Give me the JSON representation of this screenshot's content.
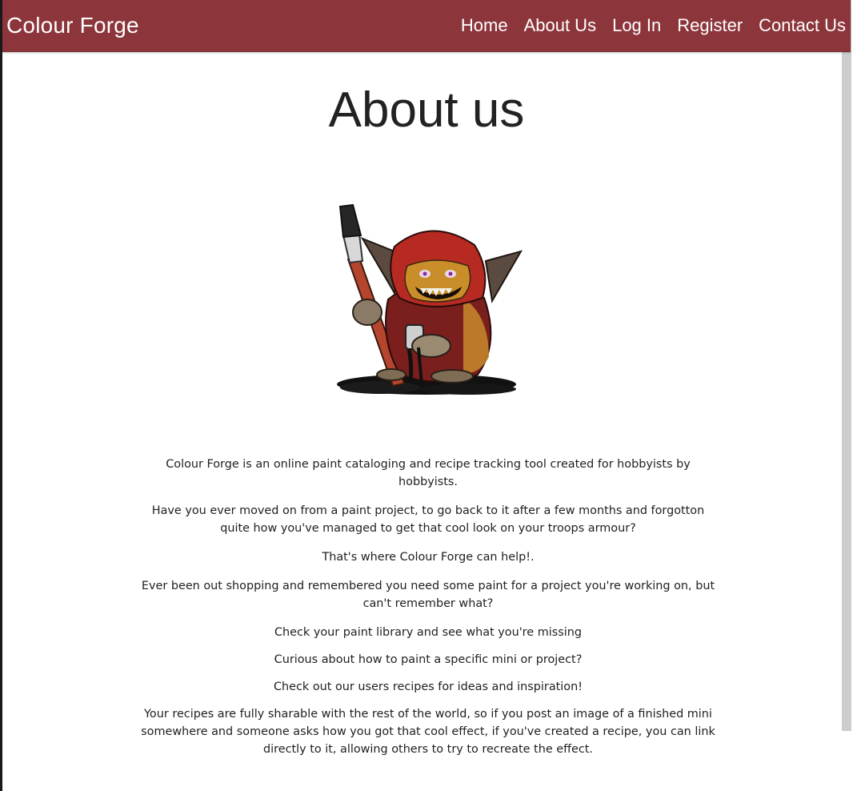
{
  "header": {
    "brand": "Colour Forge",
    "nav": [
      "Home",
      "About Us",
      "Log In",
      "Register",
      "Contact Us"
    ]
  },
  "page": {
    "title": "About us",
    "paragraphs": [
      "Colour Forge is an online paint cataloging and recipe tracking tool created for hobbyists by hobbyists.",
      "Have you ever moved on from a paint project, to go back to it after a few months and forgotton quite how you've managed to get that cool look on your troops armour?",
      "That's where Colour Forge can help!.",
      "Ever been out shopping and remembered you need some paint for a project you're working on, but can't remember what?",
      "Check your paint library and see what you're missing",
      "Curious about how to paint a specific mini or project?",
      "Check out our users recipes for ideas and inspiration!",
      "Your recipes are fully sharable with the rest of the world, so if you post an image of a finished mini somewhere and someone asks how you got that cool effect, if you've created a recipe, you can link directly to it, allowing others to try to recreate the effect."
    ]
  },
  "colors": {
    "navbar": "#8c353b",
    "nav_text": "#ffffff",
    "body_text": "#1f1f1f"
  },
  "icons": {
    "hero": "goblin-painter-illustration"
  }
}
